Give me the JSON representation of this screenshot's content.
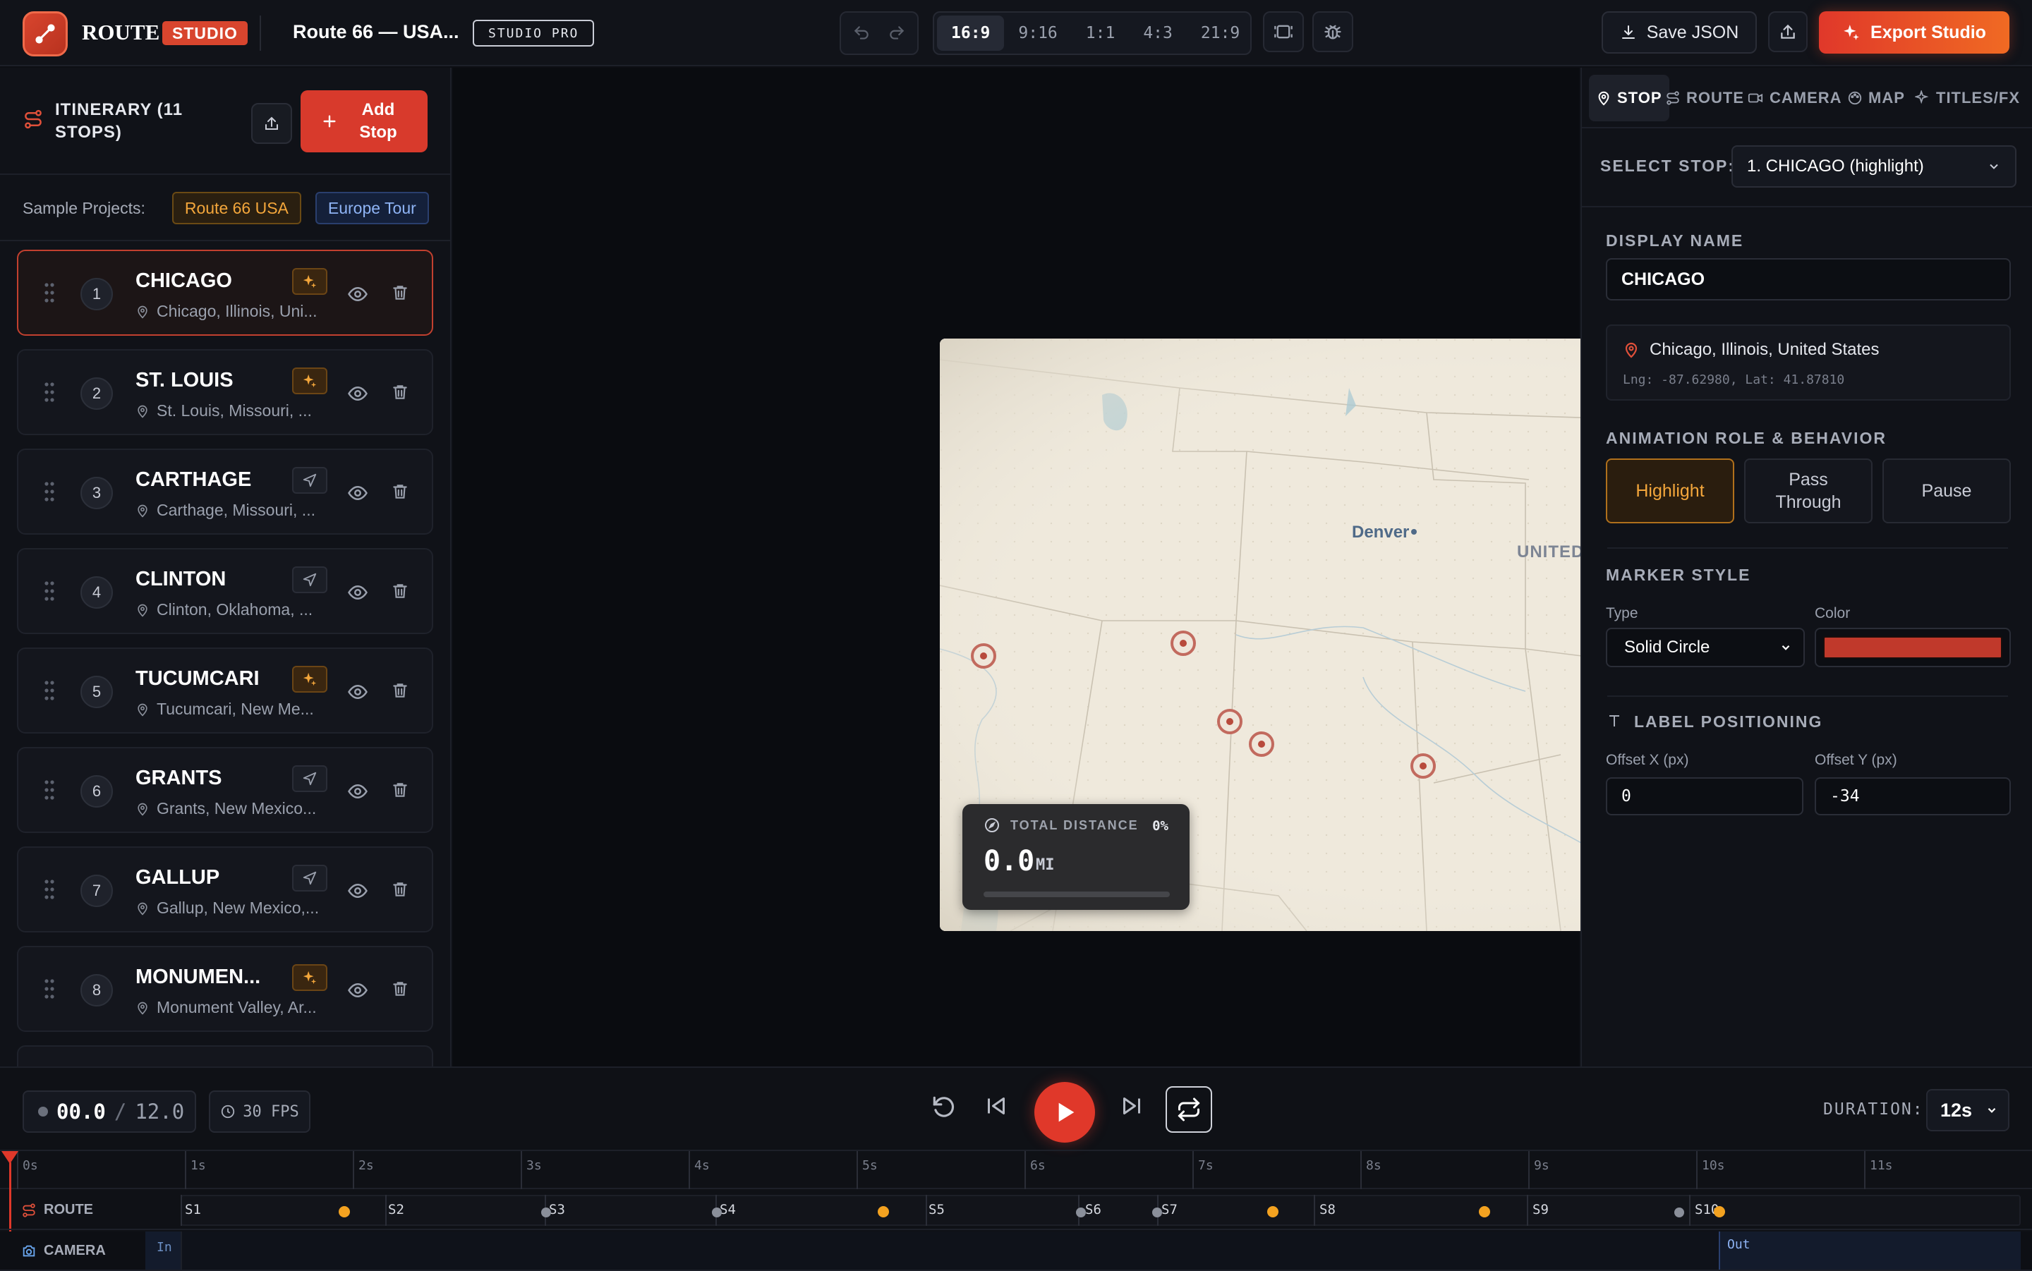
{
  "header": {
    "brand": "ROUTE",
    "brand_badge": "STUDIO",
    "project_title": "Route 66 — USA...",
    "plan_badge": "STUDIO PRO",
    "aspect_ratios": [
      "16:9",
      "9:16",
      "1:1",
      "4:3",
      "21:9"
    ],
    "active_ratio": "16:9",
    "save_label": "Save JSON",
    "export_label": "Export Studio"
  },
  "itinerary": {
    "title": "ITINERARY (11 STOPS)",
    "add_label": "Add Stop",
    "samples_label": "Sample Projects:",
    "samples": [
      "Route 66 USA",
      "Europe Tour"
    ],
    "stops": [
      {
        "num": "1",
        "name": "CHICAGO",
        "location": "Chicago, Illinois, Uni...",
        "role": "highlight"
      },
      {
        "num": "2",
        "name": "ST. LOUIS",
        "location": "St. Louis, Missouri, ...",
        "role": "highlight"
      },
      {
        "num": "3",
        "name": "CARTHAGE",
        "location": "Carthage, Missouri, ...",
        "role": "pass"
      },
      {
        "num": "4",
        "name": "CLINTON",
        "location": "Clinton, Oklahoma, ...",
        "role": "pass"
      },
      {
        "num": "5",
        "name": "TUCUMCARI",
        "location": "Tucumcari, New Me...",
        "role": "highlight"
      },
      {
        "num": "6",
        "name": "GRANTS",
        "location": "Grants, New Mexico...",
        "role": "pass"
      },
      {
        "num": "7",
        "name": "GALLUP",
        "location": "Gallup, New Mexico,...",
        "role": "pass"
      },
      {
        "num": "8",
        "name": "MONUMEN...",
        "location": "Monument Valley, Ar...",
        "role": "highlight"
      }
    ]
  },
  "map": {
    "city_label": "Denver",
    "country_label": "UNITED STATES",
    "distance_label": "TOTAL DISTANCE",
    "distance_pct": "0%",
    "distance_value": "0.0",
    "distance_unit": "MI",
    "progress": 0
  },
  "inspector": {
    "tabs": [
      "STOP",
      "ROUTE",
      "CAMERA",
      "MAP",
      "TITLES/FX"
    ],
    "active_tab": "STOP",
    "select_label": "SELECT STOP:",
    "selected_stop": "1. CHICAGO (highlight)",
    "display_name_label": "DISPLAY NAME",
    "display_name": "CHICAGO",
    "full_location": "Chicago, Illinois, United States",
    "coords": "Lng: -87.62980, Lat: 41.87810",
    "role_label": "ANIMATION ROLE & BEHAVIOR",
    "roles": [
      "Highlight",
      "Pass Through",
      "Pause"
    ],
    "active_role": "Highlight",
    "marker_label": "MARKER STYLE",
    "type_label": "Type",
    "type_value": "Solid Circle",
    "type_options": [
      "Solid Circle"
    ],
    "color_label": "Color",
    "marker_color": "#c0392b",
    "label_pos_label": "LABEL POSITIONING",
    "offset_x_label": "Offset X (px)",
    "offset_x": "0",
    "offset_y_label": "Offset Y (px)",
    "offset_y": "-34"
  },
  "timeline": {
    "current_time": "00.0",
    "total_time": "12.0",
    "fps": "30 FPS",
    "duration_label": "DURATION:",
    "duration": "12s",
    "ticks": [
      "0s",
      "1s",
      "2s",
      "3s",
      "4s",
      "5s",
      "6s",
      "7s",
      "8s",
      "9s",
      "10s",
      "11s"
    ],
    "route_label": "ROUTE",
    "camera_label": "CAMERA",
    "camera_in": "In",
    "camera_out": "Out",
    "segments": [
      "S1",
      "S2",
      "S3",
      "S4",
      "S5",
      "S6",
      "S7",
      "S8",
      "S9",
      "S10"
    ]
  },
  "colors": {
    "accent": "#e0382a",
    "highlight": "#f3a63b",
    "map_bg": "#ece6d8"
  }
}
